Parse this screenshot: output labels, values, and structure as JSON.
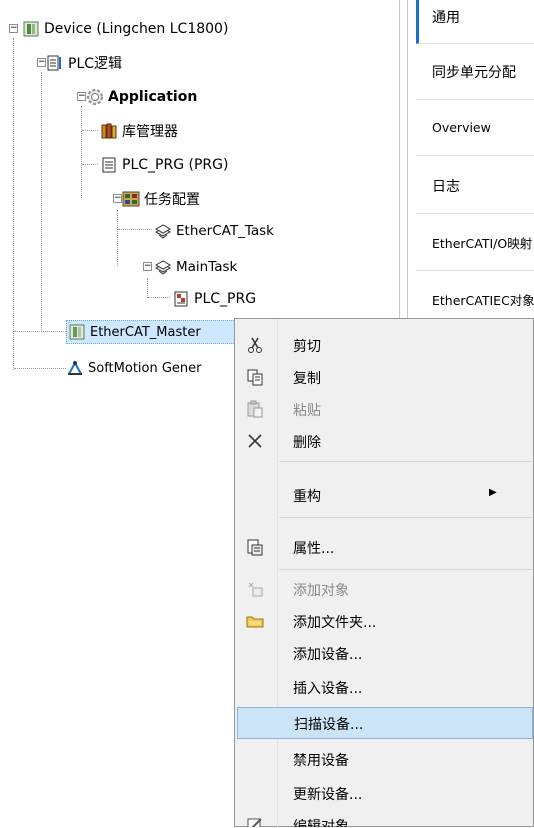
{
  "tree": {
    "device": "Device (Lingchen LC1800)",
    "plc_logic": "PLC逻辑",
    "application": "Application",
    "library_manager": "库管理器",
    "plc_prg_pou": "PLC_PRG (PRG)",
    "task_config": "任务配置",
    "ethercat_task": "EtherCAT_Task",
    "main_task": "MainTask",
    "plc_prg_call": "PLC_PRG",
    "ethercat_master": "EtherCAT_Master",
    "softmotion": "SoftMotion Gener"
  },
  "tabs": [
    "通用",
    "同步单元分配",
    "Overview",
    "日志",
    "EtherCATI/O映射",
    "EtherCATIEC对象"
  ],
  "context_menu": {
    "cut": "剪切",
    "copy": "复制",
    "paste": "粘贴",
    "delete": "删除",
    "refactor": "重构",
    "properties": "属性...",
    "add_object": "添加对象",
    "add_folder": "添加文件夹...",
    "add_device": "添加设备...",
    "insert_device": "插入设备...",
    "scan_devices": "扫描设备...",
    "disable_device": "禁用设备",
    "update_device": "更新设备...",
    "edit_object": "编辑对象"
  },
  "colors": {
    "accent": "#1b6fc9",
    "highlight": "#cce4f7",
    "selection": "#cde8ff"
  }
}
